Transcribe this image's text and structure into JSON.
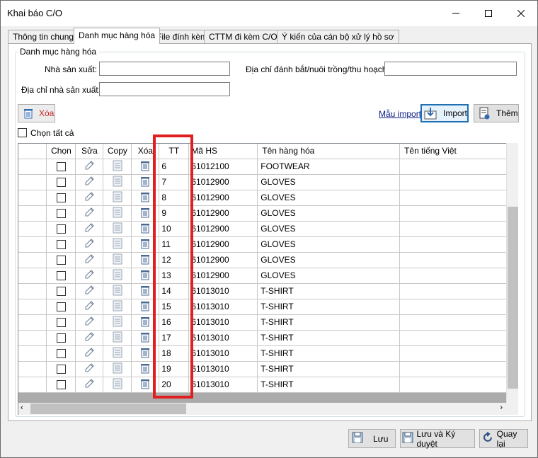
{
  "window": {
    "title": "Khai báo C/O"
  },
  "tabs": [
    {
      "label": "Thông tin chung"
    },
    {
      "label": "Danh mục hàng hóa"
    },
    {
      "label": "File đính kèm"
    },
    {
      "label": "CTTM đi kèm C/O"
    },
    {
      "label": "Ý kiến của cán bộ xử lý hồ sơ"
    }
  ],
  "group": {
    "title": "Danh mục hàng hóa"
  },
  "form": {
    "manufacturer_label": "Nhà sản xuất:",
    "manufacturer_value": "",
    "address_catch_label": "Địa chỉ đánh bắt/nuôi trồng/thu hoạch:",
    "address_catch_value": "",
    "manufacturer_address_label": "Địa chỉ nhà sản xuất:",
    "manufacturer_address_value": ""
  },
  "toolbar": {
    "delete_label": "Xóa",
    "template_link": "Mẫu import",
    "import_label": "Import",
    "add_label": "Thêm",
    "select_all_label": "Chọn tất cả"
  },
  "grid": {
    "columns": [
      "Chọn",
      "Sửa",
      "Copy",
      "Xóa",
      "TT",
      "Mã HS",
      "Tên hàng hóa",
      "Tên tiếng Việt"
    ],
    "rows": [
      {
        "tt": "6",
        "hs": "61012100",
        "name": "FOOTWEAR"
      },
      {
        "tt": "7",
        "hs": "61012900",
        "name": "GLOVES"
      },
      {
        "tt": "8",
        "hs": "61012900",
        "name": "GLOVES"
      },
      {
        "tt": "9",
        "hs": "61012900",
        "name": "GLOVES"
      },
      {
        "tt": "10",
        "hs": "61012900",
        "name": "GLOVES"
      },
      {
        "tt": "11",
        "hs": "61012900",
        "name": "GLOVES"
      },
      {
        "tt": "12",
        "hs": "61012900",
        "name": "GLOVES"
      },
      {
        "tt": "13",
        "hs": "61012900",
        "name": "GLOVES"
      },
      {
        "tt": "14",
        "hs": "61013010",
        "name": "T-SHIRT"
      },
      {
        "tt": "15",
        "hs": "61013010",
        "name": "T-SHIRT"
      },
      {
        "tt": "16",
        "hs": "61013010",
        "name": "T-SHIRT"
      },
      {
        "tt": "17",
        "hs": "61013010",
        "name": "T-SHIRT"
      },
      {
        "tt": "18",
        "hs": "61013010",
        "name": "T-SHIRT"
      },
      {
        "tt": "19",
        "hs": "61013010",
        "name": "T-SHIRT"
      },
      {
        "tt": "20",
        "hs": "61013010",
        "name": "T-SHIRT"
      }
    ]
  },
  "footer": {
    "save_label": "Lưu",
    "save_sign_label": "Lưu và Ký duyệt",
    "back_label": "Quay lại"
  },
  "colors": {
    "highlight": "#e02020",
    "link": "#0b1b86",
    "delete_text": "#c62828"
  }
}
